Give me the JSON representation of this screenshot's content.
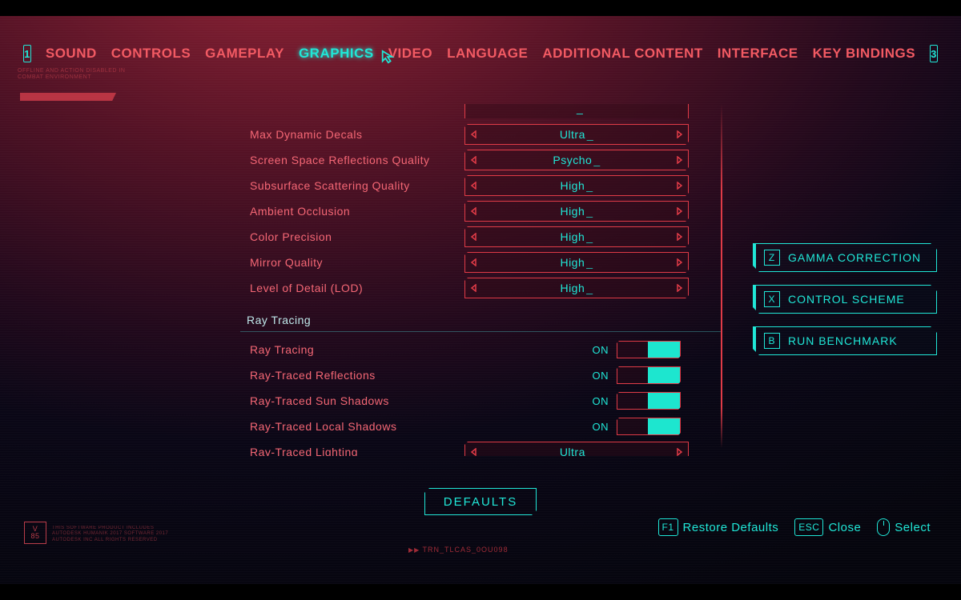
{
  "nav": {
    "prev_key": "1",
    "next_key": "3",
    "tabs": [
      "SOUND",
      "CONTROLS",
      "GAMEPLAY",
      "GRAPHICS",
      "VIDEO",
      "LANGUAGE",
      "ADDITIONAL CONTENT",
      "INTERFACE",
      "KEY BINDINGS"
    ],
    "active_index": 3
  },
  "settings": {
    "selectors": [
      {
        "label": "Max Dynamic Decals",
        "value": "Ultra"
      },
      {
        "label": "Screen Space Reflections Quality",
        "value": "Psycho"
      },
      {
        "label": "Subsurface Scattering Quality",
        "value": "High"
      },
      {
        "label": "Ambient Occlusion",
        "value": "High"
      },
      {
        "label": "Color Precision",
        "value": "High"
      },
      {
        "label": "Mirror Quality",
        "value": "High"
      },
      {
        "label": "Level of Detail (LOD)",
        "value": "High"
      }
    ],
    "section": "Ray Tracing",
    "toggles": [
      {
        "label": "Ray Tracing",
        "state": "ON"
      },
      {
        "label": "Ray-Traced Reflections",
        "state": "ON"
      },
      {
        "label": "Ray-Traced Sun Shadows",
        "state": "ON"
      },
      {
        "label": "Ray-Traced Local Shadows",
        "state": "ON"
      }
    ],
    "rt_lighting": {
      "label": "Ray-Traced Lighting",
      "value": "Ultra"
    }
  },
  "side_actions": [
    {
      "key": "Z",
      "label": "GAMMA CORRECTION"
    },
    {
      "key": "X",
      "label": "CONTROL SCHEME"
    },
    {
      "key": "B",
      "label": "RUN BENCHMARK"
    }
  ],
  "defaults_btn": "DEFAULTS",
  "footer": {
    "restore": {
      "key": "F1",
      "label": "Restore Defaults"
    },
    "close": {
      "key": "ESC",
      "label": "Close"
    },
    "select": {
      "label": "Select"
    }
  },
  "deco": {
    "tl_text": "OFFLINE AND ACTION DISABLED IN COMBAT ENVIRONMENT",
    "bl_v": "V",
    "bl_85": "85",
    "bl_text": "THIS SOFTWARE PRODUCT INCLUDES AUTODESK HUMANIK 2017 SOFTWARE 2017 AUTODESK INC ALL RIGHTS RESERVED",
    "bm": "TRN_TLCAS_0OU098"
  }
}
